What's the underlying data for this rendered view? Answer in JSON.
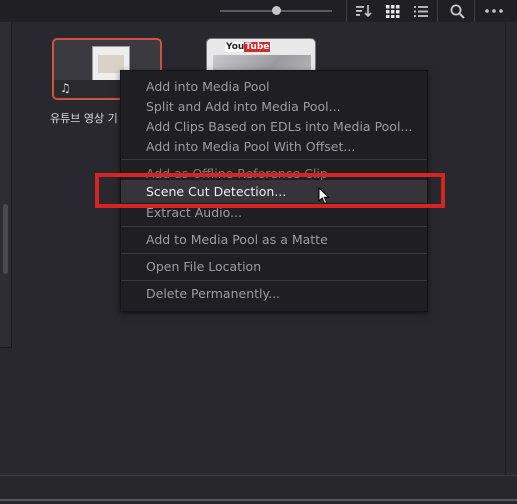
{
  "toolbar": {
    "zoom_level": 0.5,
    "icons": [
      "sort-icon",
      "grid-view-icon",
      "list-view-icon",
      "search-icon",
      "more-options-icon"
    ]
  },
  "clips": [
    {
      "label": "유튜브 영상 기",
      "thumbnail_note": "♫"
    },
    {
      "thumbnail_logo_text": "You",
      "thumbnail_logo_badge": "Tube"
    }
  ],
  "context_menu": {
    "items": [
      {
        "label": "Add into Media Pool"
      },
      {
        "label": "Split and Add into Media Pool..."
      },
      {
        "label": "Add Clips Based on EDLs into Media Pool..."
      },
      {
        "label": "Add into Media Pool With Offset..."
      },
      {
        "label": "Add as Offline Reference Clip"
      },
      {
        "label": "Scene Cut Detection..."
      },
      {
        "label": "Extract Audio..."
      },
      {
        "label": "Add to Media Pool as a Matte"
      },
      {
        "label": "Open File Location"
      },
      {
        "label": "Delete Permanently..."
      }
    ],
    "highlighted": "Scene Cut Detection..."
  },
  "colors": {
    "annotation_box": "#d52424",
    "clip_selection_border": "#d2523f"
  }
}
